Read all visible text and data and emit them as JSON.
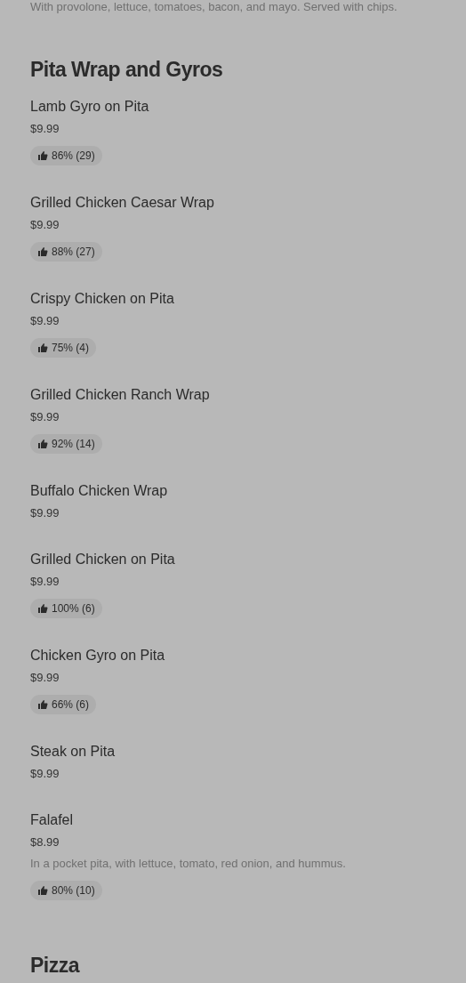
{
  "previous_item_description": "With provolone, lettuce, tomatoes, bacon, and mayo. Served with chips.",
  "sections": [
    {
      "title": "Pita Wrap and Gyros",
      "items": [
        {
          "name": "Lamb Gyro on Pita",
          "price": "$9.99",
          "rating": "86% (29)"
        },
        {
          "name": "Grilled Chicken Caesar Wrap",
          "price": "$9.99",
          "rating": "88% (27)"
        },
        {
          "name": "Crispy Chicken on Pita",
          "price": "$9.99",
          "rating": "75% (4)"
        },
        {
          "name": "Grilled Chicken Ranch Wrap",
          "price": "$9.99",
          "rating": "92% (14)"
        },
        {
          "name": "Buffalo Chicken Wrap",
          "price": "$9.99"
        },
        {
          "name": "Grilled Chicken on Pita",
          "price": "$9.99",
          "rating": "100% (6)"
        },
        {
          "name": "Chicken Gyro on Pita",
          "price": "$9.99",
          "rating": "66% (6)"
        },
        {
          "name": "Steak on Pita",
          "price": "$9.99"
        },
        {
          "name": "Falafel",
          "price": "$8.99",
          "description": "In a pocket pita, with lettuce, tomato, red onion, and hummus.",
          "rating": "80% (10)"
        }
      ]
    },
    {
      "title": "Pizza"
    }
  ]
}
